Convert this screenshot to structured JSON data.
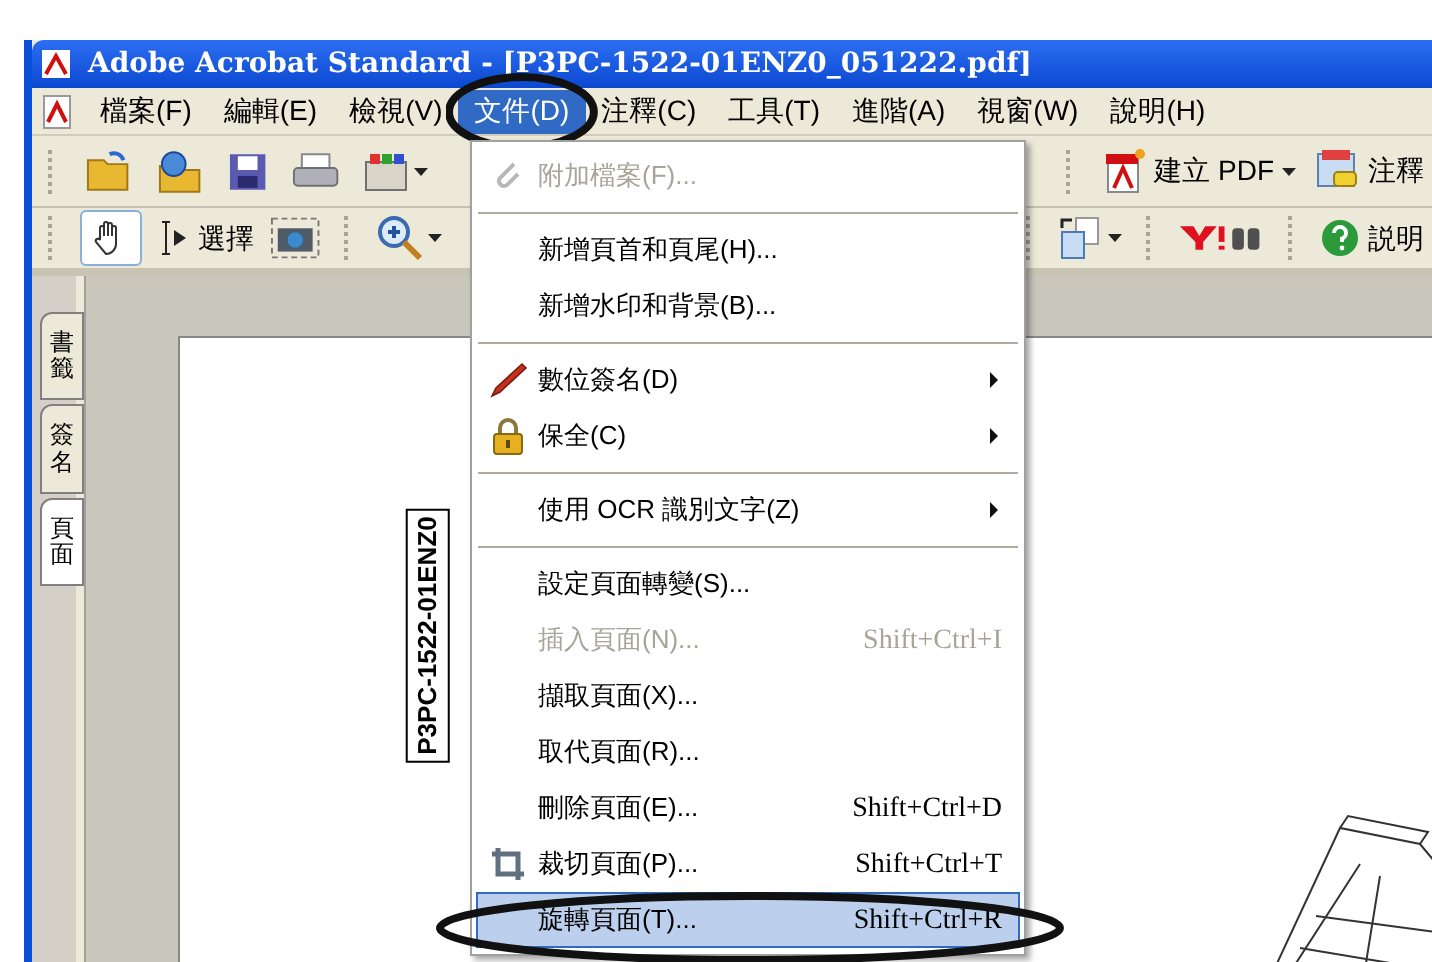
{
  "window": {
    "title": "Adobe Acrobat Standard - [P3PC-1522-01ENZ0_051222.pdf]"
  },
  "menubar": [
    {
      "label": "檔案(F)",
      "selected": false
    },
    {
      "label": "編輯(E)",
      "selected": false
    },
    {
      "label": "檢視(V)",
      "selected": false
    },
    {
      "label": "文件(D)",
      "selected": true
    },
    {
      "label": "注釋(C)",
      "selected": false
    },
    {
      "label": "工具(T)",
      "selected": false
    },
    {
      "label": "進階(A)",
      "selected": false
    },
    {
      "label": "視窗(W)",
      "selected": false
    },
    {
      "label": "說明(H)",
      "selected": false
    }
  ],
  "toolbar_1": {
    "create_pdf": "建立 PDF",
    "comment": "注釋"
  },
  "toolbar_2": {
    "hand_selected": true,
    "select": "選擇",
    "help": "説明"
  },
  "nav_tabs": [
    {
      "label": "書籤",
      "selected": false
    },
    {
      "label": "簽名",
      "selected": false
    },
    {
      "label": "頁面",
      "selected": true
    }
  ],
  "document": {
    "page_label": "P3PC-1522-01ENZ0"
  },
  "menu": [
    {
      "kind": "item",
      "label": "附加檔案(F)...",
      "disabled": true,
      "selected": false
    },
    {
      "kind": "separator"
    },
    {
      "kind": "item",
      "label": "新增頁首和頁尾(H)...",
      "disabled": false,
      "selected": false
    },
    {
      "kind": "item",
      "label": "新增水印和背景(B)...",
      "disabled": false,
      "selected": false
    },
    {
      "kind": "separator"
    },
    {
      "kind": "item",
      "label": "數位簽名(D)",
      "submenu": true,
      "disabled": false,
      "selected": false
    },
    {
      "kind": "item",
      "label": "保全(C)",
      "submenu": true,
      "disabled": false,
      "selected": false
    },
    {
      "kind": "separator"
    },
    {
      "kind": "item",
      "label": "使用 OCR 識別文字(Z)",
      "submenu": true,
      "disabled": false,
      "selected": false
    },
    {
      "kind": "separator"
    },
    {
      "kind": "item",
      "label": "設定頁面轉變(S)...",
      "disabled": false,
      "selected": false
    },
    {
      "kind": "item",
      "label": "插入頁面(N)...",
      "shortcut": "Shift+Ctrl+I",
      "disabled": true,
      "selected": false
    },
    {
      "kind": "item",
      "label": "擷取頁面(X)...",
      "disabled": false,
      "selected": false
    },
    {
      "kind": "item",
      "label": "取代頁面(R)...",
      "disabled": false,
      "selected": false
    },
    {
      "kind": "item",
      "label": "刪除頁面(E)...",
      "shortcut": "Shift+Ctrl+D",
      "disabled": false,
      "selected": false
    },
    {
      "kind": "item",
      "label": "裁切頁面(P)...",
      "shortcut": "Shift+Ctrl+T",
      "disabled": false,
      "selected": false
    },
    {
      "kind": "item",
      "label": "旋轉頁面(T)...",
      "shortcut": "Shift+Ctrl+R",
      "disabled": false,
      "selected": true
    }
  ]
}
